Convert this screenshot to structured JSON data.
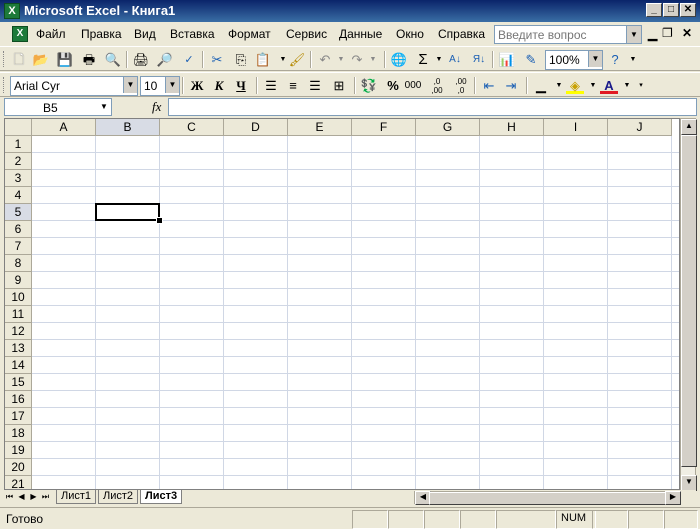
{
  "window": {
    "title": "Microsoft Excel - Книга1",
    "app_icon": "X"
  },
  "menu": {
    "items": [
      "Файл",
      "Правка",
      "Вид",
      "Вставка",
      "Формат",
      "Сервис",
      "Данные",
      "Окно",
      "Справка"
    ],
    "help_placeholder": "Введите вопрос"
  },
  "standard_toolbar": {
    "zoom": "100%"
  },
  "format_toolbar": {
    "font_name": "Arial Cyr",
    "font_size": "10",
    "bold": "Ж",
    "italic": "К",
    "underline": "Ч",
    "percent": "%",
    "thousands": "000",
    "inc_decimal": ",0 ,00",
    "dec_decimal": ",00 ,0"
  },
  "formula_bar": {
    "name_box": "B5",
    "fx": "fx",
    "value": ""
  },
  "grid": {
    "columns": [
      "A",
      "B",
      "C",
      "D",
      "E",
      "F",
      "G",
      "H",
      "I",
      "J"
    ],
    "rows": [
      "1",
      "2",
      "3",
      "4",
      "5",
      "6",
      "7",
      "8",
      "9",
      "10",
      "11",
      "12",
      "13",
      "14",
      "15",
      "16",
      "17",
      "18",
      "19",
      "20",
      "21"
    ],
    "active_column": "B",
    "active_row": "5"
  },
  "sheets": {
    "tabs": [
      "Лист1",
      "Лист2",
      "Лист3"
    ],
    "active": "Лист3"
  },
  "status": {
    "text": "Готово",
    "num": "NUM"
  },
  "colors": {
    "title_start": "#0a246a",
    "title_end": "#3a6ea5",
    "chrome": "#ece9d8",
    "grid_line": "#d0d7e5"
  }
}
